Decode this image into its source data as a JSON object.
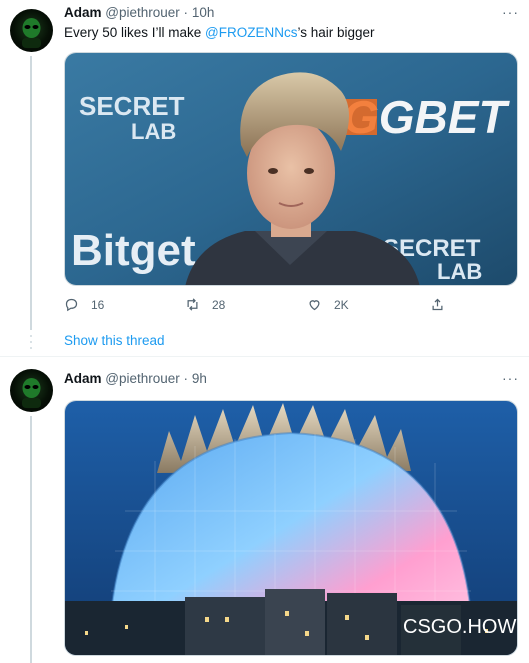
{
  "tweet1": {
    "name": "Adam",
    "handle": "@piethrouer",
    "separator": "·",
    "time": "10h",
    "more": "···",
    "text_before": "Every 50 likes I’ll make ",
    "mention": "@FROZENNcs",
    "text_after": "’s hair bigger",
    "image": {
      "banner_left_top": "SECRET",
      "banner_left_bottom": "LAB",
      "banner_right_top": "GGBET",
      "banner_sponsor": "Bitget",
      "banner_right_bottom_top": "SECRET",
      "banner_right_bottom_bottom": "LAB"
    },
    "actions": {
      "reply_count": "16",
      "retweet_count": "28",
      "like_count": "2K"
    },
    "show_thread": "Show this thread"
  },
  "tweet2": {
    "name": "Adam",
    "handle": "@piethrouer",
    "separator": "·",
    "time": "9h",
    "more": "···",
    "image": {
      "watermark": "CSGO.HOW"
    }
  },
  "colors": {
    "link": "#1d9bf0",
    "secondary_text": "#536471",
    "border": "#cfd9de"
  },
  "icons": [
    "reply-icon",
    "retweet-icon",
    "like-icon",
    "share-icon",
    "more-icon"
  ]
}
